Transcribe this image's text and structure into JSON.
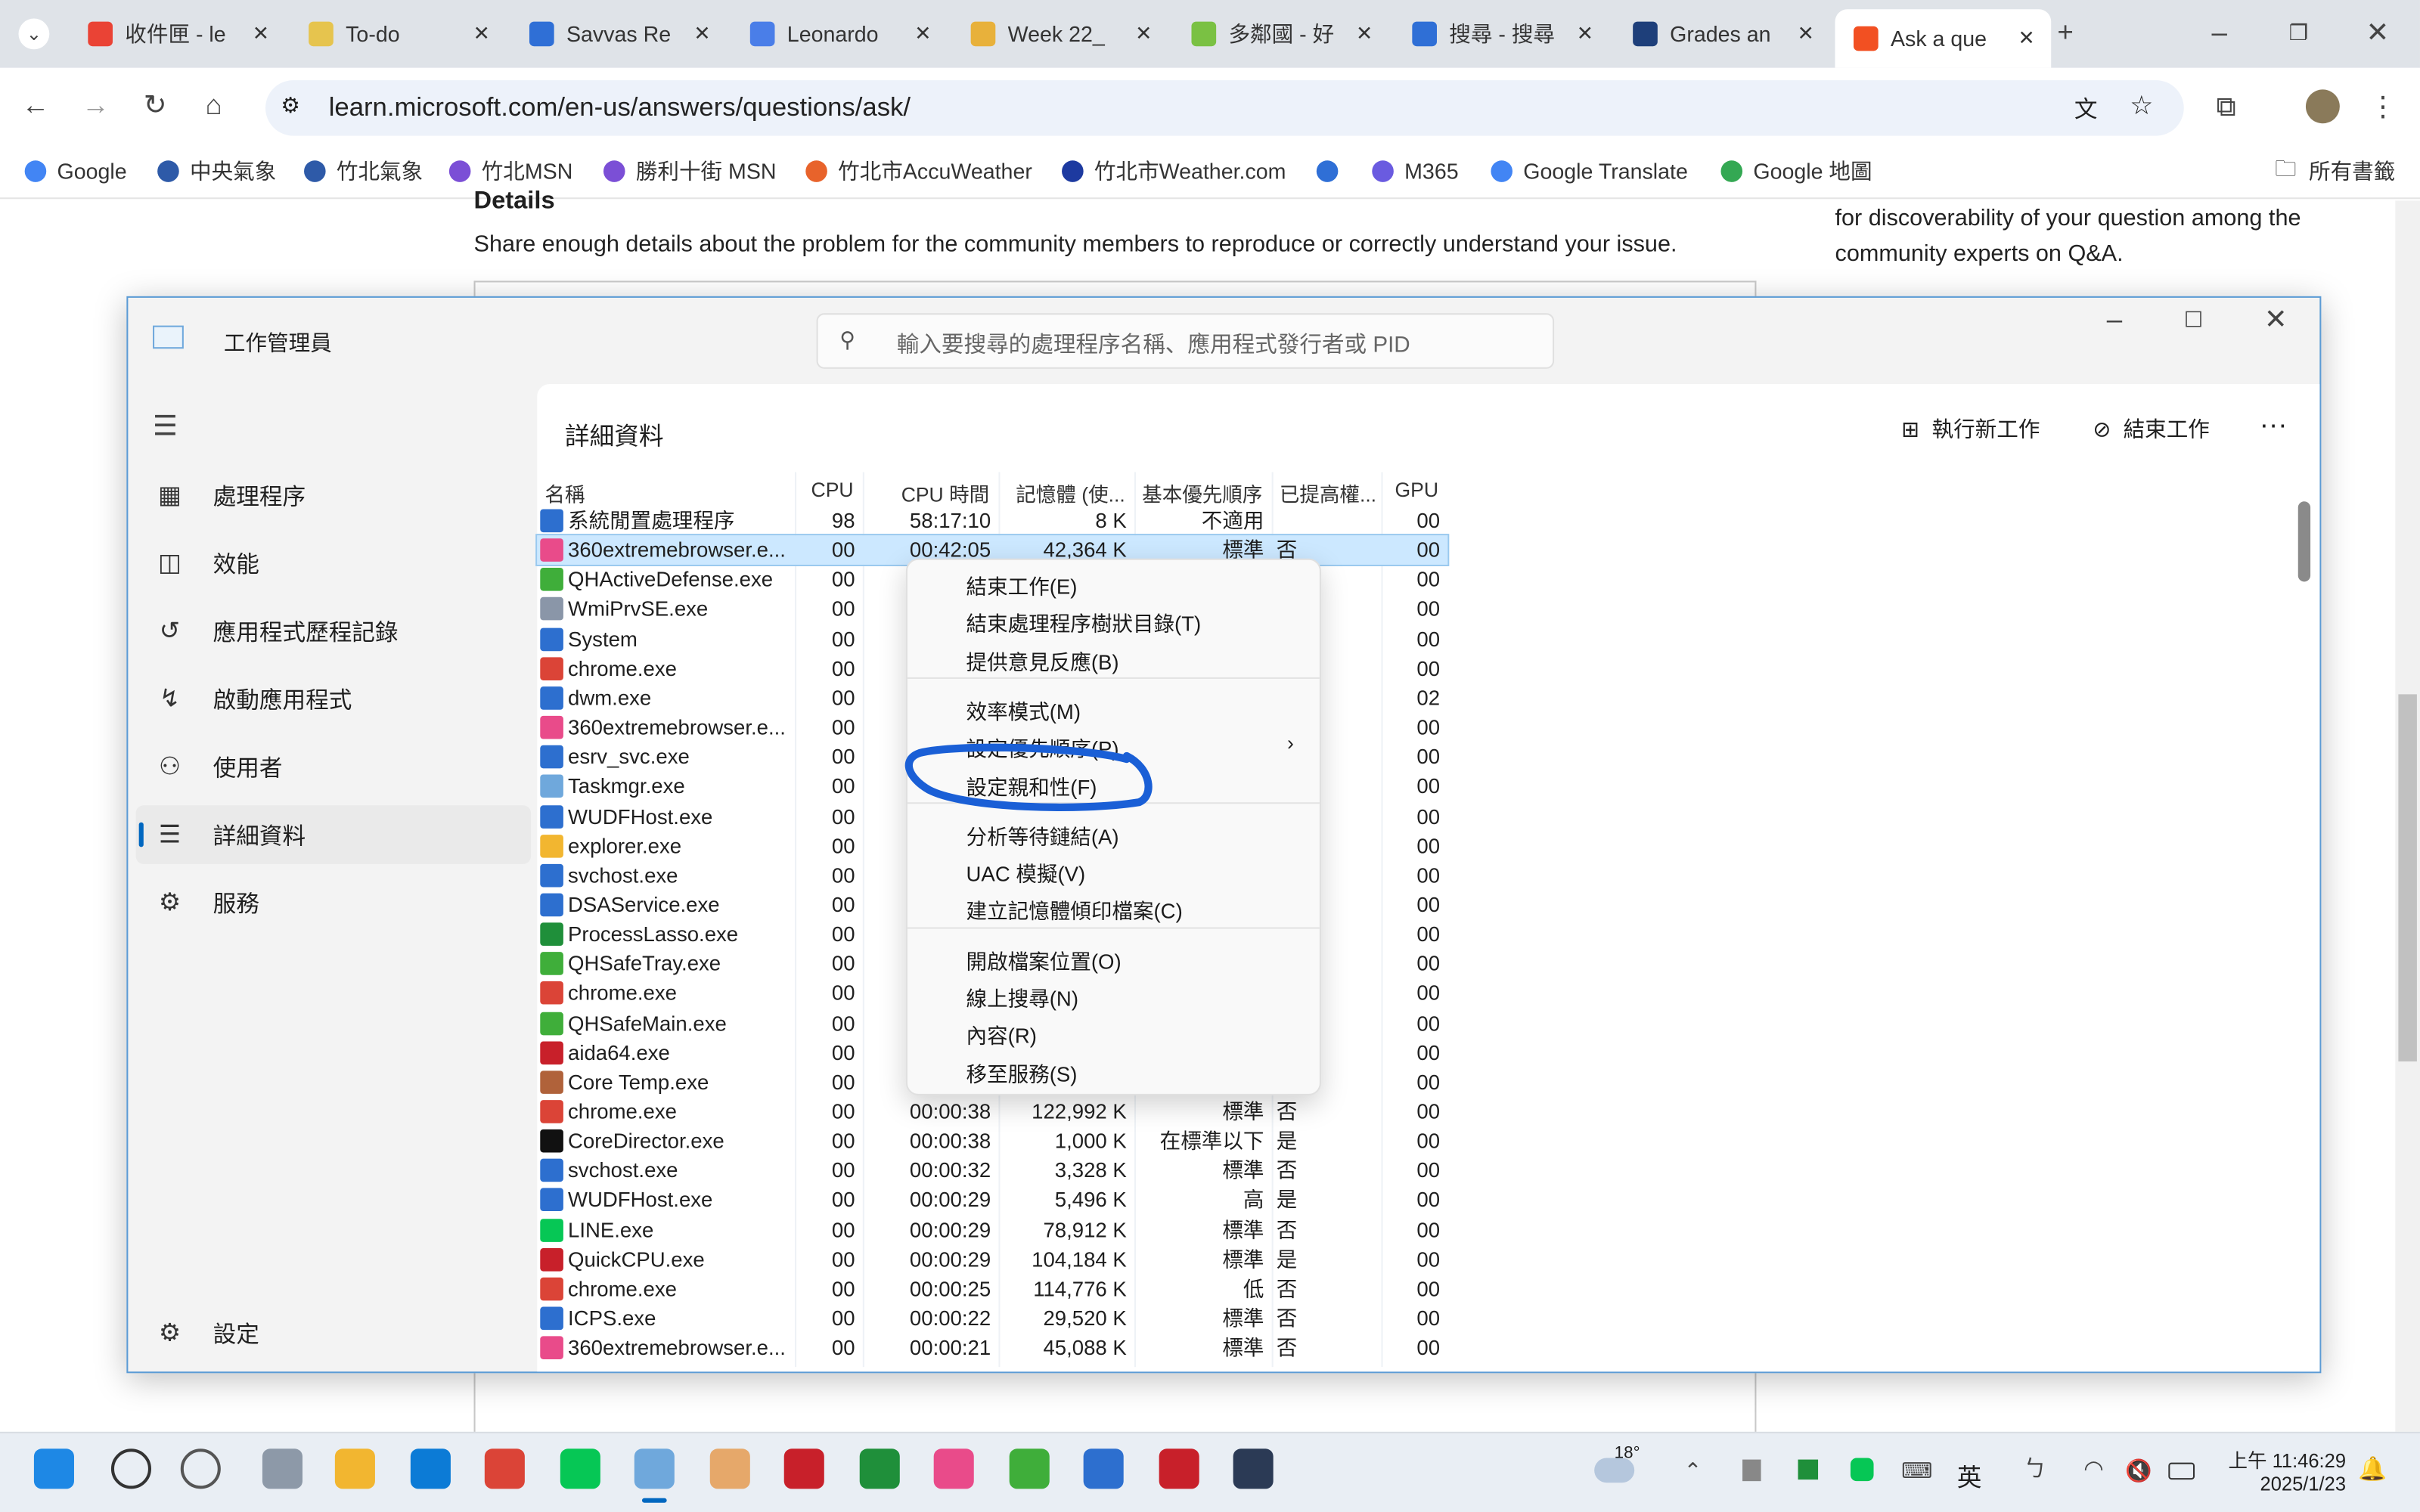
{
  "browser": {
    "tabs": [
      {
        "label": "收件匣 - le",
        "color": "#ea4335"
      },
      {
        "label": "To-do",
        "color": "#e6c44e"
      },
      {
        "label": "Savvas Re",
        "color": "#2f6fd6"
      },
      {
        "label": "Leonardo",
        "color": "#4a7ee8"
      },
      {
        "label": "Week 22_",
        "color": "#e8b13b"
      },
      {
        "label": "多鄰國 - 好",
        "color": "#7ac143"
      },
      {
        "label": "搜尋 - 搜尋",
        "color": "#2f6fd6"
      },
      {
        "label": "Grades an",
        "color": "#1e3f7a"
      },
      {
        "label": "Ask a que",
        "color": "#f25022",
        "active": true
      }
    ],
    "url": "learn.microsoft.com/en-us/answers/questions/ask/",
    "bookmarks": [
      {
        "label": "Google",
        "color": "#4285f4"
      },
      {
        "label": "中央氣象",
        "color": "#2e5aa8"
      },
      {
        "label": "竹北氣象",
        "color": "#2e5aa8"
      },
      {
        "label": "竹北MSN",
        "color": "#7b4fd6"
      },
      {
        "label": "勝利十街 MSN",
        "color": "#7b4fd6"
      },
      {
        "label": "竹北市AccuWeather",
        "color": "#e8632b"
      },
      {
        "label": "竹北市Weather.com",
        "color": "#1d3aa0"
      },
      {
        "label": "",
        "color": "#2f6fd6"
      },
      {
        "label": "M365",
        "color": "#6a5be0"
      },
      {
        "label": "Google Translate",
        "color": "#4285f4"
      },
      {
        "label": "Google 地圖",
        "color": "#34a853"
      }
    ],
    "all_bookmarks": "所有書籤"
  },
  "page": {
    "details_heading": "Details",
    "details_help": "Share enough details about the problem for the community members to reproduce or correctly understand your issue.",
    "side_text_1": "for discoverability of your question among the",
    "side_text_2": "community experts on Q&A."
  },
  "taskmgr": {
    "title": "工作管理員",
    "search_placeholder": "輸入要搜尋的處理程序名稱、應用程式發行者或 PID",
    "nav": [
      {
        "label": "處理程序",
        "icon": "▦"
      },
      {
        "label": "效能",
        "icon": "◫"
      },
      {
        "label": "應用程式歷程記錄",
        "icon": "↺"
      },
      {
        "label": "啟動應用程式",
        "icon": "↯"
      },
      {
        "label": "使用者",
        "icon": "⚇"
      },
      {
        "label": "詳細資料",
        "icon": "☰",
        "selected": true
      },
      {
        "label": "服務",
        "icon": "⚙"
      }
    ],
    "settings": "設定",
    "section_title": "詳細資料",
    "run_new_task": "執行新工作",
    "end_task": "結束工作",
    "columns": [
      "名稱",
      "CPU",
      "CPU 時間",
      "記憶體 (使...",
      "基本優先順序",
      "已提高權...",
      "GPU"
    ],
    "rows": [
      {
        "name": "系統閒置處理程序",
        "cpu": "98",
        "time": "58:17:10",
        "mem": "8 K",
        "prio": "不適用",
        "elev": "",
        "gpu": "00",
        "icon": "#2d6fcf"
      },
      {
        "name": "360extremebrowser.e...",
        "cpu": "00",
        "time": "00:42:05",
        "mem": "42,364 K",
        "prio": "標準",
        "elev": "否",
        "gpu": "00",
        "icon": "#e94b8a",
        "selected": true
      },
      {
        "name": "QHActiveDefense.exe",
        "cpu": "00",
        "gpu": "00",
        "icon": "#3fae3a"
      },
      {
        "name": "WmiPrvSE.exe",
        "cpu": "00",
        "gpu": "00",
        "icon": "#8a96a8"
      },
      {
        "name": "System",
        "cpu": "00",
        "gpu": "00",
        "icon": "#2d6fcf"
      },
      {
        "name": "chrome.exe",
        "cpu": "00",
        "gpu": "00",
        "icon": "#db4437"
      },
      {
        "name": "dwm.exe",
        "cpu": "00",
        "gpu": "02",
        "icon": "#2d6fcf"
      },
      {
        "name": "360extremebrowser.e...",
        "cpu": "00",
        "gpu": "00",
        "icon": "#e94b8a"
      },
      {
        "name": "esrv_svc.exe",
        "cpu": "00",
        "gpu": "00",
        "icon": "#2d6fcf"
      },
      {
        "name": "Taskmgr.exe",
        "cpu": "00",
        "gpu": "00",
        "icon": "#6fa8dc"
      },
      {
        "name": "WUDFHost.exe",
        "cpu": "00",
        "gpu": "00",
        "icon": "#2d6fcf"
      },
      {
        "name": "explorer.exe",
        "cpu": "00",
        "gpu": "00",
        "icon": "#f2b630"
      },
      {
        "name": "svchost.exe",
        "cpu": "00",
        "gpu": "00",
        "icon": "#2d6fcf"
      },
      {
        "name": "DSAService.exe",
        "cpu": "00",
        "gpu": "00",
        "icon": "#2d6fcf"
      },
      {
        "name": "ProcessLasso.exe",
        "cpu": "00",
        "gpu": "00",
        "icon": "#1f8f3a"
      },
      {
        "name": "QHSafeTray.exe",
        "cpu": "00",
        "gpu": "00",
        "icon": "#3fae3a"
      },
      {
        "name": "chrome.exe",
        "cpu": "00",
        "gpu": "00",
        "icon": "#db4437"
      },
      {
        "name": "QHSafeMain.exe",
        "cpu": "00",
        "gpu": "00",
        "icon": "#3fae3a"
      },
      {
        "name": "aida64.exe",
        "cpu": "00",
        "gpu": "00",
        "icon": "#c8202a"
      },
      {
        "name": "Core Temp.exe",
        "cpu": "00",
        "gpu": "00",
        "icon": "#b0623a"
      },
      {
        "name": "chrome.exe",
        "cpu": "00",
        "time": "00:00:38",
        "mem": "122,992 K",
        "prio": "標準",
        "elev": "否",
        "gpu": "00",
        "icon": "#db4437"
      },
      {
        "name": "CoreDirector.exe",
        "cpu": "00",
        "time": "00:00:38",
        "mem": "1,000 K",
        "prio": "在標準以下",
        "elev": "是",
        "gpu": "00",
        "icon": "#111111"
      },
      {
        "name": "svchost.exe",
        "cpu": "00",
        "time": "00:00:32",
        "mem": "3,328 K",
        "prio": "標準",
        "elev": "否",
        "gpu": "00",
        "icon": "#2d6fcf"
      },
      {
        "name": "WUDFHost.exe",
        "cpu": "00",
        "time": "00:00:29",
        "mem": "5,496 K",
        "prio": "高",
        "elev": "是",
        "gpu": "00",
        "icon": "#2d6fcf"
      },
      {
        "name": "LINE.exe",
        "cpu": "00",
        "time": "00:00:29",
        "mem": "78,912 K",
        "prio": "標準",
        "elev": "否",
        "gpu": "00",
        "icon": "#06c755"
      },
      {
        "name": "QuickCPU.exe",
        "cpu": "00",
        "time": "00:00:29",
        "mem": "104,184 K",
        "prio": "標準",
        "elev": "是",
        "gpu": "00",
        "icon": "#c8202a"
      },
      {
        "name": "chrome.exe",
        "cpu": "00",
        "time": "00:00:25",
        "mem": "114,776 K",
        "prio": "低",
        "elev": "否",
        "gpu": "00",
        "icon": "#db4437"
      },
      {
        "name": "ICPS.exe",
        "cpu": "00",
        "time": "00:00:22",
        "mem": "29,520 K",
        "prio": "標準",
        "elev": "否",
        "gpu": "00",
        "icon": "#2d6fcf"
      },
      {
        "name": "360extremebrowser.e...",
        "cpu": "00",
        "time": "00:00:21",
        "mem": "45,088 K",
        "prio": "標準",
        "elev": "否",
        "gpu": "00",
        "icon": "#e94b8a"
      }
    ],
    "context_menu": [
      {
        "label": "結束工作(E)"
      },
      {
        "label": "結束處理程序樹狀目錄(T)"
      },
      {
        "label": "提供意見反應(B)",
        "sep_after": true
      },
      {
        "label": "效率模式(M)"
      },
      {
        "label": "設定優先順序(P)",
        "submenu": true
      },
      {
        "label": "設定親和性(F)",
        "annotated": true,
        "sep_after": true
      },
      {
        "label": "分析等待鏈結(A)"
      },
      {
        "label": "UAC 模擬(V)"
      },
      {
        "label": "建立記憶體傾印檔案(C)",
        "sep_after": true
      },
      {
        "label": "開啟檔案位置(O)"
      },
      {
        "label": "線上搜尋(N)"
      },
      {
        "label": "內容(R)"
      },
      {
        "label": "移至服務(S)"
      }
    ],
    "annotation_color": "#1a5fd6"
  },
  "taskbar": {
    "apps": [
      "#1e88e5",
      "#333333",
      "#555555",
      "#8d99a8",
      "#f2b630",
      "#0c7bd6",
      "#db4437",
      "#06c755",
      "#6fa8dc",
      "#e6a86a",
      "#c8202a",
      "#1f8f3a",
      "#e94b8a",
      "#3fae3a",
      "#2d6fcf",
      "#c8202a",
      "#2b3a55"
    ],
    "weather": "18°",
    "ime": "英",
    "time": "上午 11:46:29",
    "date": "2025/1/23"
  }
}
